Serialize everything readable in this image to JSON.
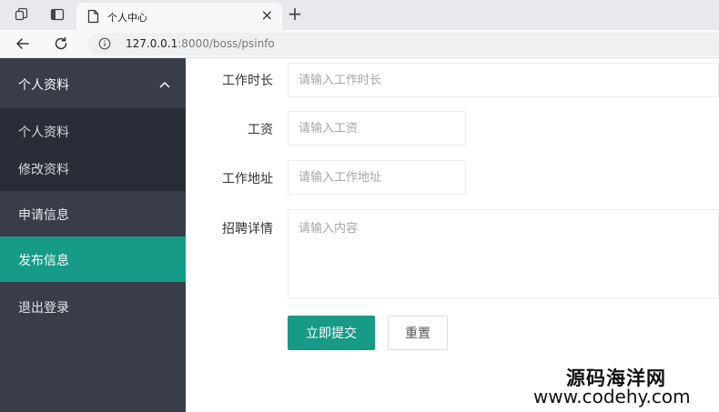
{
  "browser": {
    "tab_title": "个人中心",
    "tab_close": "×",
    "new_tab": "+",
    "url_host": "127.0.0.1",
    "url_rest": ":8000/boss/psinfo"
  },
  "sidebar": {
    "group_label": "个人资料",
    "sub_items": [
      "个人资料",
      "修改资料"
    ],
    "items": [
      "申请信息",
      "发布信息",
      "退出登录"
    ],
    "active_item": "发布信息"
  },
  "form": {
    "duration_label": "工作时长",
    "duration_placeholder": "请输入工作时长",
    "salary_label": "工资",
    "salary_placeholder": "请输入工资",
    "address_label": "工作地址",
    "address_placeholder": "请输入工作地址",
    "details_label": "招聘详情",
    "details_placeholder": "请输入内容",
    "submit_label": "立即提交",
    "reset_label": "重置"
  },
  "watermark": {
    "name": "源码海洋网",
    "url": "www.codehy.com"
  },
  "colors": {
    "sidebar_bg": "#393d49",
    "sidebar_sub_bg": "#2a2d38",
    "accent": "#179a86"
  }
}
